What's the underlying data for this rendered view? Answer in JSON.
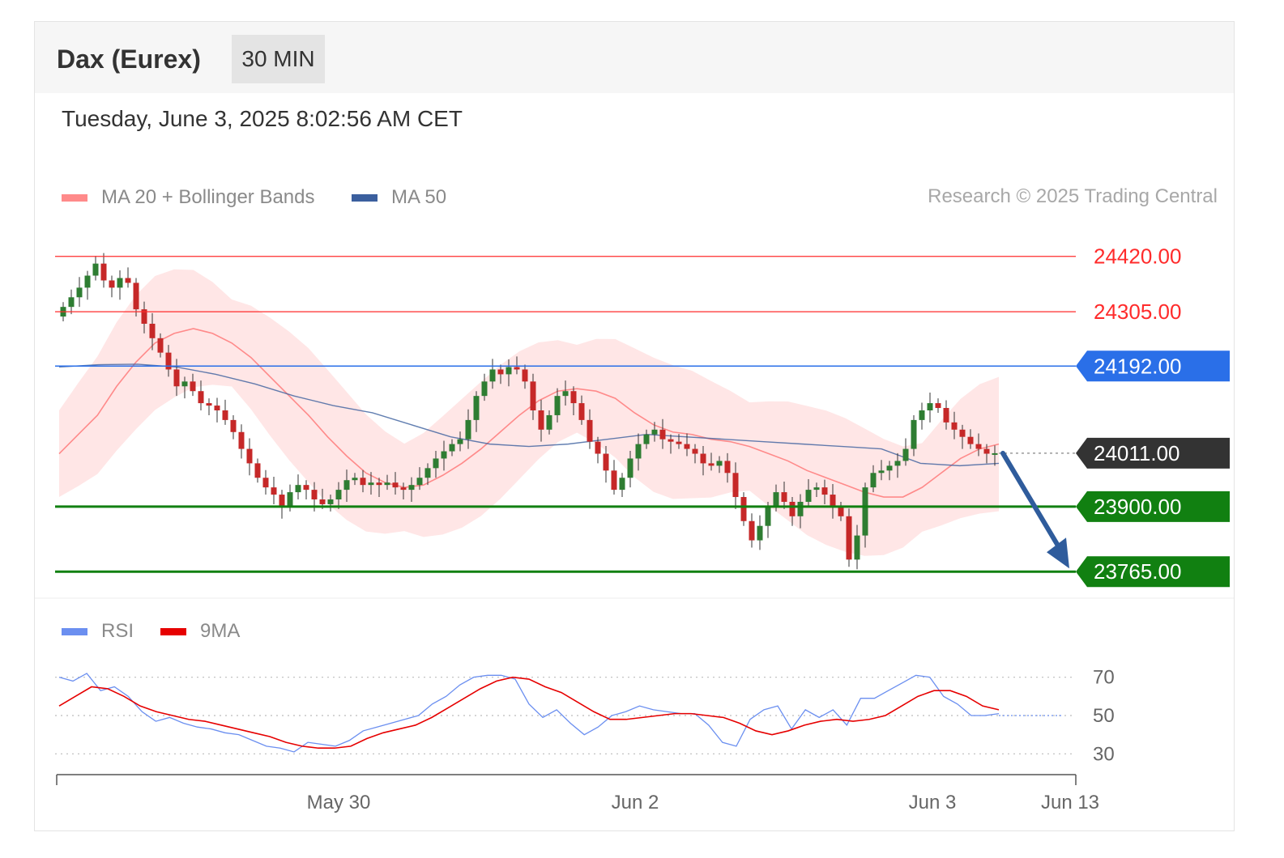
{
  "header": {
    "title": "Dax (Eurex)",
    "timeframe": "30 MIN"
  },
  "datetime": "Tuesday, June 3, 2025 8:02:56 AM CET",
  "legend": {
    "ma20_bb": "MA 20 + Bollinger Bands",
    "ma50": "MA 50",
    "rsi": "RSI",
    "rsi_ma": "9MA"
  },
  "copyright": "Research © 2025 Trading Central",
  "colors": {
    "ma20": "#ff8a8a",
    "band": "#ffe6e6",
    "ma50": "#3b5f9e",
    "resistance": "#ff2b2b",
    "pivot": "#2a6fe8",
    "support": "#118011",
    "last": "#333333",
    "bull": "#2e7d32",
    "bear": "#c62828",
    "rsi": "#6b8ff0",
    "rsi_ma": "#e60000",
    "arrow": "#2f5c9c"
  },
  "chart_data": [
    {
      "type": "candlestick",
      "title": "Dax (Eurex)",
      "timeframe": "30 MIN",
      "x_ticks": [
        "May 30",
        "Jun 2",
        "Jun 3",
        "Jun 13"
      ],
      "ylim": [
        23730,
        24470
      ],
      "levels": [
        {
          "value": 24420,
          "label": "24420.00",
          "kind": "resistance"
        },
        {
          "value": 24305,
          "label": "24305.00",
          "kind": "resistance"
        },
        {
          "value": 24192,
          "label": "24192.00",
          "kind": "pivot"
        },
        {
          "value": 24011,
          "label": "24011.00",
          "kind": "last"
        },
        {
          "value": 23900,
          "label": "23900.00",
          "kind": "support"
        },
        {
          "value": 23765,
          "label": "23765.00",
          "kind": "support"
        }
      ],
      "forecast": {
        "from": 24011,
        "to": 23765,
        "direction": "down"
      },
      "close_series": [
        24315,
        24335,
        24355,
        24380,
        24405,
        24370,
        24355,
        24375,
        24365,
        24310,
        24280,
        24250,
        24220,
        24185,
        24150,
        24160,
        24140,
        24115,
        24110,
        24100,
        24080,
        24055,
        24020,
        23990,
        23960,
        23940,
        23925,
        23900,
        23930,
        23945,
        23935,
        23915,
        23905,
        23915,
        23935,
        23955,
        23960,
        23945,
        23950,
        23945,
        23950,
        23940,
        23935,
        23945,
        23960,
        23980,
        24000,
        24015,
        24030,
        24040,
        24080,
        24130,
        24160,
        24185,
        24175,
        24190,
        24185,
        24160,
        24100,
        24060,
        24090,
        24130,
        24140,
        24115,
        24080,
        24035,
        24010,
        23975,
        23935,
        23960,
        24000,
        24030,
        24050,
        24060,
        24040,
        24035,
        24030,
        24020,
        24010,
        23990,
        23985,
        23995,
        23970,
        23920,
        23870,
        23830,
        23860,
        23900,
        23930,
        23910,
        23880,
        23910,
        23935,
        23940,
        23925,
        23900,
        23880,
        23790,
        23840,
        23940,
        23970,
        23975,
        23985,
        23995,
        24020,
        24080,
        24100,
        24115,
        24105,
        24075,
        24060,
        24045,
        24030,
        24020,
        24010,
        24011
      ],
      "ma20": [
        24010,
        24050,
        24090,
        24150,
        24200,
        24240,
        24260,
        24270,
        24260,
        24240,
        24210,
        24170,
        24130,
        24090,
        24045,
        24005,
        23970,
        23950,
        23940,
        23945,
        23965,
        23990,
        24020,
        24055,
        24090,
        24120,
        24140,
        24145,
        24140,
        24125,
        24095,
        24070,
        24055,
        24050,
        24040,
        24035,
        24025,
        24010,
        23995,
        23975,
        23960,
        23945,
        23930,
        23920,
        23920,
        23940,
        23970,
        24000,
        24020,
        24030
      ],
      "ma50": [
        24190,
        24195,
        24196,
        24190,
        24175,
        24155,
        24130,
        24110,
        24095,
        24070,
        24045,
        24030,
        24025,
        24030,
        24040,
        24050,
        24045,
        24040,
        24035,
        24030,
        24025,
        24020,
        23990,
        23985,
        23990
      ],
      "y_labels": [
        "24420.00",
        "24305.00",
        "24192.00",
        "24011.00",
        "23900.00",
        "23765.00"
      ]
    },
    {
      "type": "line",
      "title": "RSI",
      "y_ticks": [
        70,
        50,
        30
      ],
      "ylim": [
        20,
        80
      ],
      "series": [
        {
          "name": "RSI",
          "values": [
            70,
            68,
            72,
            63,
            65,
            60,
            52,
            47,
            49,
            46,
            44,
            43,
            41,
            40,
            37,
            34,
            33,
            31,
            36,
            35,
            34,
            37,
            42,
            44,
            46,
            48,
            50,
            56,
            60,
            66,
            70,
            71,
            71,
            69,
            56,
            49,
            53,
            46,
            40,
            44,
            50,
            52,
            55,
            53,
            52,
            51,
            51,
            45,
            36,
            34,
            48,
            53,
            55,
            43,
            53,
            49,
            53,
            45,
            59,
            59,
            63,
            67,
            71,
            70,
            60,
            56,
            50,
            50,
            51
          ]
        },
        {
          "name": "9MA",
          "values": [
            55,
            60,
            65,
            64,
            60,
            55,
            52,
            50,
            48,
            47,
            45,
            43,
            41,
            39,
            36,
            34,
            33,
            33,
            34,
            38,
            41,
            43,
            45,
            49,
            54,
            59,
            64,
            68,
            70,
            69,
            65,
            62,
            57,
            52,
            48,
            48,
            49,
            50,
            51,
            51,
            50,
            49,
            46,
            42,
            40,
            42,
            45,
            47,
            48,
            47,
            48,
            50,
            55,
            60,
            63,
            63,
            60,
            55,
            53
          ]
        }
      ]
    }
  ]
}
